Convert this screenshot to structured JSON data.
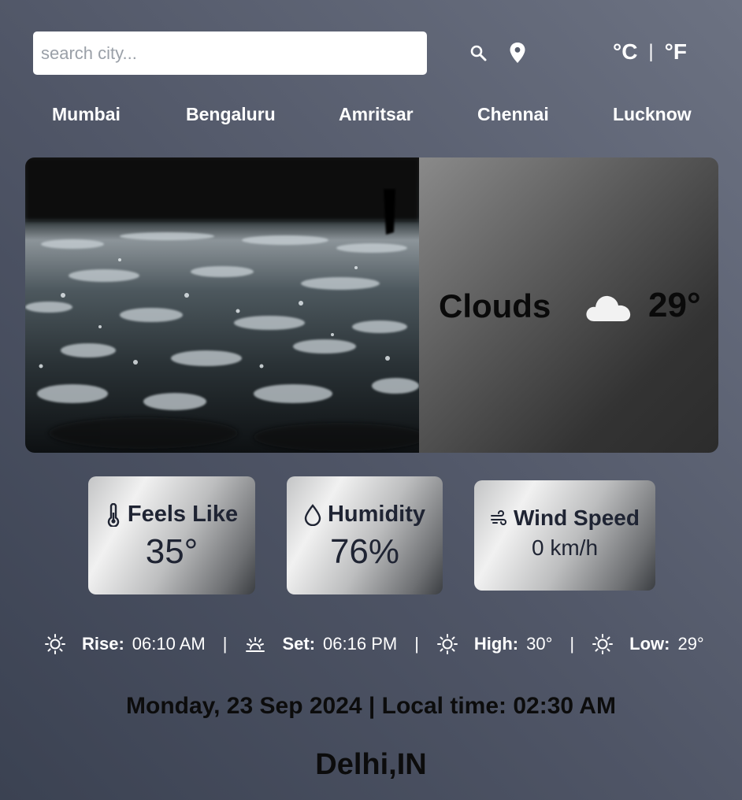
{
  "search": {
    "placeholder": "search city..."
  },
  "icons": {
    "search": "search-icon",
    "location": "location-pin-icon"
  },
  "units": {
    "celsius": "°C",
    "separator": "|",
    "fahrenheit": "°F"
  },
  "cities": [
    "Mumbai",
    "Bengaluru",
    "Amritsar",
    "Chennai",
    "Lucknow"
  ],
  "weather": {
    "condition": "Clouds",
    "temperature": "29°",
    "condition_icon": "cloud-icon"
  },
  "stats": {
    "feels_like": {
      "label": "Feels Like",
      "value": "35°",
      "icon": "thermometer-icon"
    },
    "humidity": {
      "label": "Humidity",
      "value": "76%",
      "icon": "droplet-icon"
    },
    "wind": {
      "label": "Wind Speed",
      "value": "0 km/h",
      "icon": "wind-icon"
    }
  },
  "sun": {
    "rise_label": "Rise:",
    "rise_value": "06:10 AM",
    "set_label": "Set:",
    "set_value": "06:16 PM",
    "high_label": "High:",
    "high_value": "30°",
    "low_label": "Low:",
    "low_value": "29°",
    "separator": "|"
  },
  "datetime": "Monday, 23 Sep 2024 | Local time: 02:30 AM",
  "location": "Delhi,IN",
  "colors": {
    "text_dark": "#0a0a0a",
    "tile_text": "#1f2433",
    "bg_start": "#3b4252",
    "bg_end": "#6c7282"
  }
}
